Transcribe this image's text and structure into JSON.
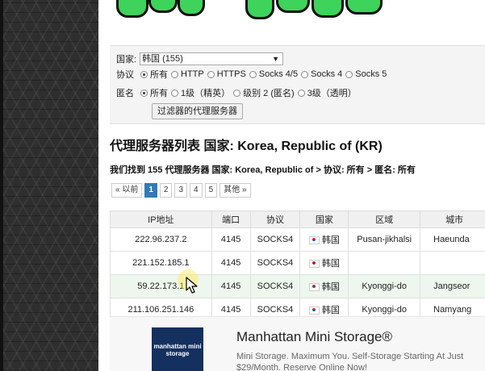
{
  "filter": {
    "country_label": "国家:",
    "country_value": "韩国 (155)",
    "protocol_label": "协议",
    "protocol_options": [
      "所有",
      "HTTP",
      "HTTPS",
      "Socks 4/5",
      "Socks 4",
      "Socks 5"
    ],
    "anonymity_label": "匿名",
    "anonymity_options": [
      "所有",
      "1级（精英）",
      "级别 2 (匿名)",
      "3级（透明）"
    ],
    "submit_label": "过滤器的代理服务器"
  },
  "page_title": "代理服务器列表 国家: Korea, Republic of (KR)",
  "summary": "我们找到 155 代理服务器 国家: Korea, Republic of > 协议: 所有 > 匿名: 所有",
  "pagination": {
    "prev": "« 以前",
    "pages": [
      "1",
      "2",
      "3",
      "4",
      "5"
    ],
    "active": "1",
    "next": "其他 »"
  },
  "table": {
    "headers": [
      "IP地址",
      "端口",
      "协议",
      "国家",
      "区域",
      "城市"
    ],
    "rows": [
      {
        "ip": "222.96.237.2",
        "port": "4145",
        "protocol": "SOCKS4",
        "country": "韩国",
        "region": "Pusan-jikhalsi",
        "city": "Haeunda"
      },
      {
        "ip": "221.152.185.1",
        "port": "4145",
        "protocol": "SOCKS4",
        "country": "韩国",
        "region": "",
        "city": ""
      },
      {
        "ip": "59.22.173.1",
        "port": "4145",
        "protocol": "SOCKS4",
        "country": "韩国",
        "region": "Kyonggi-do",
        "city": "Jangseor"
      },
      {
        "ip": "211.106.251.146",
        "port": "4145",
        "protocol": "SOCKS4",
        "country": "韩国",
        "region": "Kyonggi-do",
        "city": "Namyang"
      }
    ]
  },
  "ad": {
    "logo_text": "manhattan mini storage",
    "title": "Manhattan Mini Storage®",
    "description": "Mini Storage. Maximum You. Self-Storage Starting At Just $29/Month. Reserve Online Now!"
  },
  "colors": {
    "active_page": "#337ab7",
    "banner_green": "#3ed35a",
    "ad_logo": "#14305f"
  }
}
